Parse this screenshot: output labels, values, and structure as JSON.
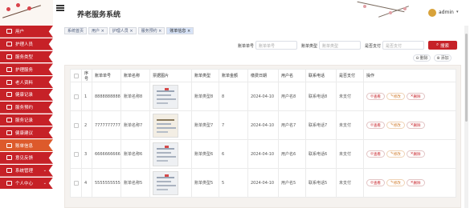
{
  "app": {
    "title": "养老服务系统"
  },
  "user": {
    "name": "admin",
    "caret": "▾"
  },
  "sidebar": {
    "items": [
      {
        "label": "用户",
        "icon": "users-icon"
      },
      {
        "label": "护理人员",
        "icon": "nurse-icon"
      },
      {
        "label": "服务类型",
        "icon": "category-icon"
      },
      {
        "label": "护理服务",
        "icon": "care-icon"
      },
      {
        "label": "老人资料",
        "icon": "profile-icon"
      },
      {
        "label": "健康记录",
        "icon": "health-icon"
      },
      {
        "label": "服务预约",
        "icon": "calendar-icon"
      },
      {
        "label": "服务记录",
        "icon": "record-icon"
      },
      {
        "label": "健康建议",
        "icon": "advice-icon"
      },
      {
        "label": "账单信息",
        "icon": "bill-icon",
        "active": true
      },
      {
        "label": "意见反馈",
        "icon": "feedback-icon"
      },
      {
        "label": "系统管理",
        "icon": "settings-icon",
        "expand": true
      },
      {
        "label": "个人中心",
        "icon": "person-icon",
        "expand": true
      }
    ]
  },
  "tabs": [
    {
      "label": "系统首页"
    },
    {
      "label": "用户 ×"
    },
    {
      "label": "护理人员 ×"
    },
    {
      "label": "服务预约 ×"
    },
    {
      "label": "账单信息 ×",
      "active": true
    }
  ],
  "search": {
    "no_label": "账单单号",
    "no_placeholder": "账单单号",
    "type_label": "账单类型",
    "type_placeholder": "账单类型",
    "status_label": "是否支付",
    "status_placeholder": "是否支付",
    "button": "搜索"
  },
  "actions": {
    "delete": "删除",
    "add": "添加"
  },
  "table": {
    "columns": [
      "序号",
      "账单单号",
      "账单名称",
      "票据图片",
      "账单类型",
      "账单金额",
      "缴费日期",
      "用户名",
      "联系电话",
      "是否支付",
      "操作"
    ],
    "rows": [
      {
        "idx": "1",
        "no": "8888888888",
        "name": "账单名称8",
        "type": "账单类型8",
        "amount": "8",
        "date": "2024-04-10",
        "user": "用户名8",
        "phone": "联系电话8",
        "paid": "未支付"
      },
      {
        "idx": "2",
        "no": "7777777777",
        "name": "账单名称7",
        "type": "账单类型7",
        "amount": "7",
        "date": "2024-04-10",
        "user": "用户名7",
        "phone": "联系电话7",
        "paid": "未支付"
      },
      {
        "idx": "3",
        "no": "6666666666",
        "name": "账单名称6",
        "type": "账单类型6",
        "amount": "6",
        "date": "2024-04-10",
        "user": "用户名6",
        "phone": "联系电话6",
        "paid": "未支付"
      },
      {
        "idx": "4",
        "no": "5555555555",
        "name": "账单名称5",
        "type": "账单类型5",
        "amount": "5",
        "date": "2024-04-10",
        "user": "用户名5",
        "phone": "联系电话5",
        "paid": "未支付"
      }
    ],
    "row_actions": {
      "view": "查看",
      "edit": "修改",
      "delete": "删除"
    }
  },
  "colors": {
    "accent": "#c62127",
    "active": "#dd5a2b"
  }
}
